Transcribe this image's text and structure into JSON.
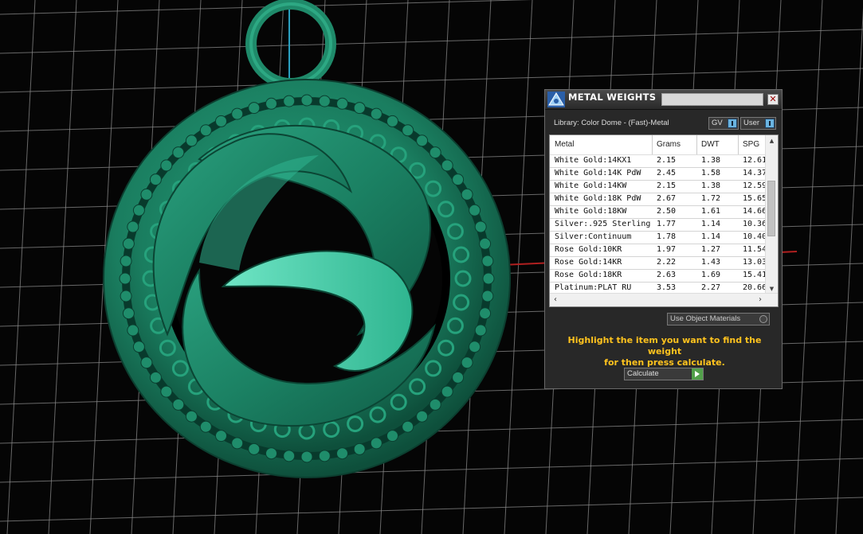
{
  "panel": {
    "title": "METAL WEIGHTS",
    "close_glyph": "✕",
    "library_label": "Library: Color Dome - (Fast)-Metal",
    "toggle_gv": "GV",
    "toggle_user": "User",
    "use_object_materials": "Use Object Materials",
    "hint_line1": "Highlight the item you want to find the weight",
    "hint_line2": "for then press calculate.",
    "calculate_label": "Calculate"
  },
  "table": {
    "headers": [
      "Metal",
      "Grams",
      "DWT",
      "SPG"
    ],
    "rows": [
      [
        "White Gold:14KX1",
        "2.15",
        "1.38",
        "12.61"
      ],
      [
        "White Gold:14K PdW",
        "2.45",
        "1.58",
        "14.37"
      ],
      [
        "White Gold:14KW",
        "2.15",
        "1.38",
        "12.59"
      ],
      [
        "White Gold:18K PdW",
        "2.67",
        "1.72",
        "15.65"
      ],
      [
        "White Gold:18KW",
        "2.50",
        "1.61",
        "14.66"
      ],
      [
        "Silver:.925 Sterling",
        "1.77",
        "1.14",
        "10.36"
      ],
      [
        "Silver:Continuum",
        "1.78",
        "1.14",
        "10.40"
      ],
      [
        "Rose Gold:10KR",
        "1.97",
        "1.27",
        "11.54"
      ],
      [
        "Rose Gold:14KR",
        "2.22",
        "1.43",
        "13.03"
      ],
      [
        "Rose Gold:18KR",
        "2.63",
        "1.69",
        "15.41"
      ],
      [
        "Platinum:PLAT RU",
        "3.53",
        "2.27",
        "20.66"
      ]
    ],
    "scroll_position": 0.42
  },
  "scene": {
    "background_color": "#050505",
    "grid_color": "#8a8a8a",
    "model_color": "#1d8a6a",
    "model_highlight": "#5ed8b8",
    "axis_x_color": "#c02020",
    "axis_y_color": "#20a0c0"
  },
  "icons": {
    "logo": "app-logo-icon",
    "close": "close-icon",
    "calculate": "play-arrow-icon"
  }
}
